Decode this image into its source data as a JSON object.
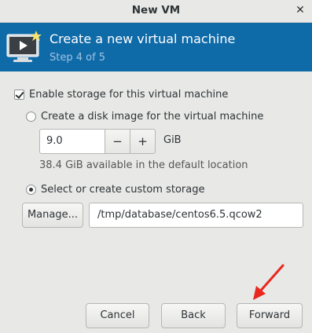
{
  "window": {
    "title": "New VM",
    "close_glyph": "✕"
  },
  "header": {
    "icon": "vm-monitor-icon",
    "title": "Create a new virtual machine",
    "step": "Step 4 of 5",
    "background": "#0f6aa8"
  },
  "storage": {
    "enable_label": "Enable storage for this virtual machine",
    "enable_checked": true,
    "disk_image_label": "Create a disk image for the virtual machine",
    "disk_image_selected": false,
    "size_value": "9.0",
    "minus_label": "−",
    "plus_label": "+",
    "size_unit": "GiB",
    "available_text": "38.4 GiB available in the default location",
    "custom_label": "Select or create custom storage",
    "custom_selected": true,
    "manage_label": "Manage...",
    "path_value": "/tmp/database/centos6.5.qcow2"
  },
  "footer": {
    "cancel_label": "Cancel",
    "back_label": "Back",
    "forward_label": "Forward"
  },
  "annotation": {
    "icon": "red-arrow-icon",
    "color": "#e8271e"
  }
}
